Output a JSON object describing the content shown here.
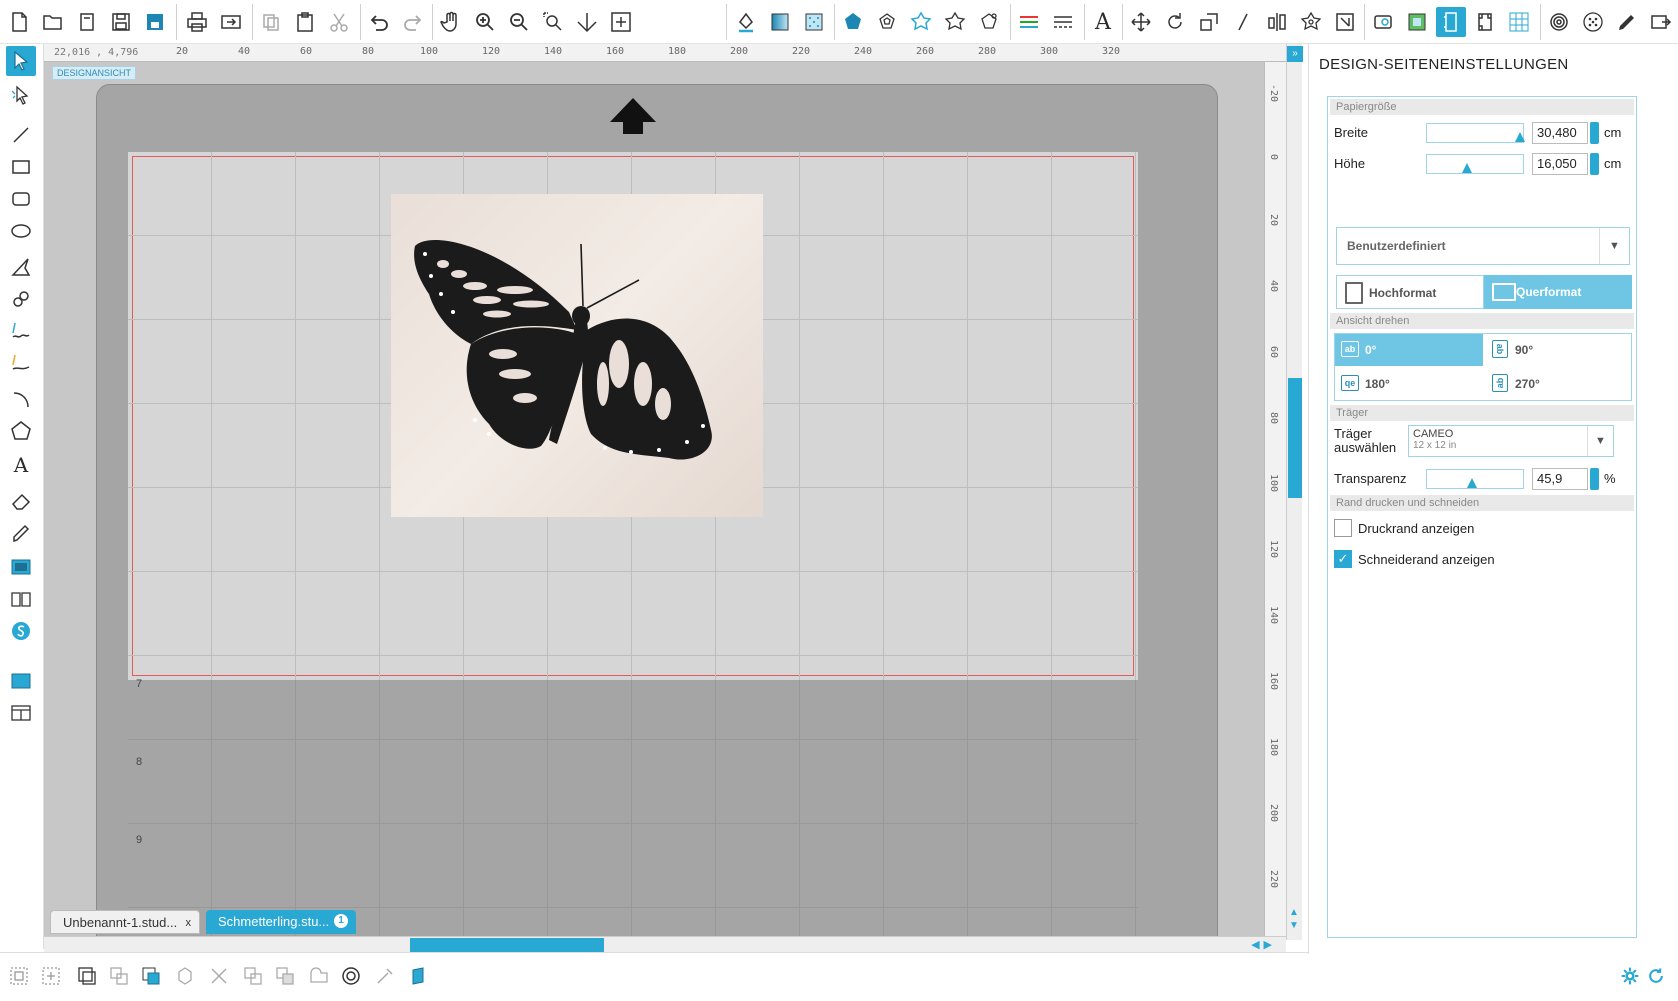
{
  "canvas": {
    "coords_readout": "22,016 , 4,796",
    "design_view_badge": "DESIGNANSICHT",
    "ruler_h": [
      "20",
      "40",
      "60",
      "80",
      "100",
      "120",
      "140",
      "160",
      "180",
      "200",
      "220",
      "240",
      "260",
      "280",
      "300",
      "320"
    ],
    "ruler_v": [
      "-20",
      "0",
      "20",
      "40",
      "60",
      "80",
      "100",
      "120",
      "140",
      "160",
      "180",
      "200",
      "220"
    ],
    "mat_rows": [
      "7",
      "8",
      "9"
    ]
  },
  "tabs": [
    {
      "label": "Unbenannt-1.stud...",
      "close": "x"
    },
    {
      "label": "Schmetterling.stu...",
      "badge": "1"
    }
  ],
  "panel": {
    "title": "DESIGN-SEITENEINSTELLUNGEN",
    "paper_size": {
      "header": "Papiergröße",
      "width_label": "Breite",
      "width_value": "30,480",
      "width_fill": 1.0,
      "height_label": "Höhe",
      "height_value": "16,050",
      "height_fill": 0.4,
      "unit": "cm",
      "preset": "Benutzerdefiniert",
      "portrait": "Hochformat",
      "landscape": "Querformat"
    },
    "rotate": {
      "header": "Ansicht drehen",
      "options": [
        {
          "label": "0°",
          "icon": "ab"
        },
        {
          "label": "90°",
          "icon": "ab"
        },
        {
          "label": "180°",
          "icon": "qe"
        },
        {
          "label": "270°",
          "icon": "ab"
        }
      ]
    },
    "carrier": {
      "header": "Träger",
      "select_label": "Träger auswählen",
      "name": "CAMEO",
      "size": "12 x 12 in",
      "transparency_label": "Transparenz",
      "transparency_value": "45,9",
      "transparency_fill": 0.459,
      "transparency_unit": "%"
    },
    "print_cut": {
      "header": "Rand drucken und schneiden",
      "show_print_border": "Druckrand anzeigen",
      "show_print_border_checked": false,
      "show_cut_border": "Schneiderand anzeigen",
      "show_cut_border_checked": true
    }
  },
  "accent_color": "#29a8d4"
}
